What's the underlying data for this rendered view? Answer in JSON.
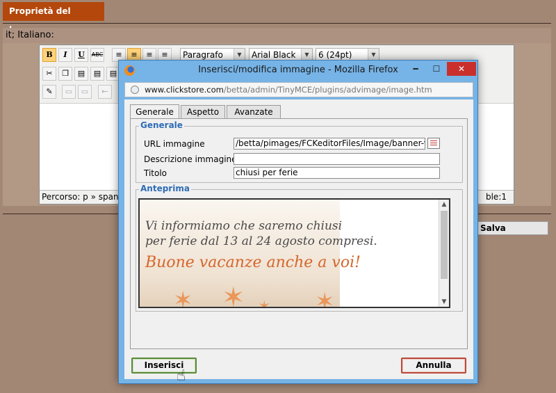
{
  "page": {
    "banner_tab": "Proprietà del banner",
    "language_label": "it; Italiano:",
    "salva_label": "Salva"
  },
  "editor": {
    "toolbar": {
      "bold": "B",
      "italic": "I",
      "underline": "U",
      "strike": "ABC",
      "format_select": "Paragrafo",
      "font_select": "Arial Black",
      "size_select": "6 (24pt)"
    },
    "status_path": "Percorso: p » span",
    "status_right": "ble:1"
  },
  "dialog": {
    "title": "Inserisci/modifica immagine - Mozilla Firefox",
    "url_host": "www.clickstore.com",
    "url_path": "/betta/admin/TinyMCE/plugins/advimage/image.htm",
    "tabs": [
      {
        "label": "Generale",
        "active": true
      },
      {
        "label": "Aspetto",
        "active": false
      },
      {
        "label": "Avanzate",
        "active": false
      }
    ],
    "general": {
      "legend": "Generale",
      "fields": [
        {
          "label": "URL immagine",
          "value": "/betta/pimages/FCKeditorFiles/Image/banner-vac"
        },
        {
          "label": "Descrizione immagine",
          "value": ""
        },
        {
          "label": "Titolo",
          "value": "chiusi per ferie"
        }
      ]
    },
    "preview": {
      "legend": "Anteprima",
      "line1": "Vi informiamo che saremo chiusi",
      "line2": "per ferie dal 13 al 24 agosto compresi.",
      "line3": "Buone vacanze anche a voi!"
    },
    "buttons": {
      "insert": "Inserisci",
      "cancel": "Annulla"
    }
  },
  "colors": {
    "background": "#a38775",
    "banner_tab": "#b3470c",
    "dialog_frame": "#76b3e6",
    "legend": "#2e6cb5",
    "preview_accent": "#d5662c"
  }
}
